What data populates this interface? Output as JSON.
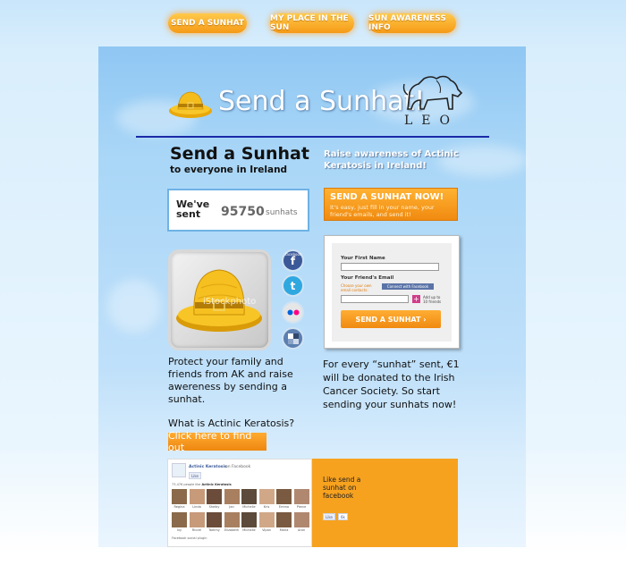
{
  "nav": {
    "send_sunhat": "SEND A SUNHAT",
    "my_place": "MY PLACE IN THE SUN",
    "awareness": "SUN AWARENESS INFO"
  },
  "header": {
    "logo_title": "Send a Sunhat!",
    "partner_logo_text": "LEO"
  },
  "intro": {
    "heading": "Send a Sunhat",
    "subheading": "to everyone in Ireland",
    "awareness": "Raise awareness of Actinic Keratosis in Ireland!"
  },
  "counter": {
    "label": "We've sent",
    "value": "95750",
    "unit": "sunhats"
  },
  "cta": {
    "title": "SEND A SUNHAT NOW!",
    "subtitle": "It's easy, just fill in your name, your friend's emails, and send it!"
  },
  "hat_image": {
    "watermark": "iStockphoto"
  },
  "social": {
    "facebook_label": "facebook"
  },
  "form": {
    "first_name_label": "Your First Name",
    "friend_email_label": "Your Friend's Email",
    "choose_contacts": "Choose your own email contacts:",
    "connect_facebook": "Connect with Facebook",
    "add_up_to": "Add up to 10 friends",
    "submit": "SEND A SUNHAT ›"
  },
  "left_text": {
    "body": "Protect your family and friends from AK and raise awereness by sending a sunhat.",
    "question": "What is Actinic Keratosis?",
    "find_out": "Click here to find out"
  },
  "right_text": {
    "body": "For every “sunhat” sent, €1 will be donated to the Irish Cancer Society. So start sending your sunhats now!"
  },
  "facebook_box": {
    "page_name": "Actinic Keratosis",
    "on_facebook": "on Facebook",
    "like": "Like",
    "fans_line_prefix": "73,476 people like",
    "fans_line_page": "Actinic Keratosis",
    "fans": [
      "Regina",
      "Linda",
      "Shelby",
      "Jan",
      "Michelle",
      "Kris",
      "Emma",
      "Pierce",
      "Ivy",
      "Riccel",
      "Tammy",
      "Elizabeth",
      "Michelle",
      "Vipan",
      "Maria",
      "Aron"
    ],
    "plugin_label": "Facebook social plugin"
  },
  "facebook_cta": {
    "text": "Like send a sunhat on facebook",
    "like": "Like",
    "count": "6k"
  }
}
